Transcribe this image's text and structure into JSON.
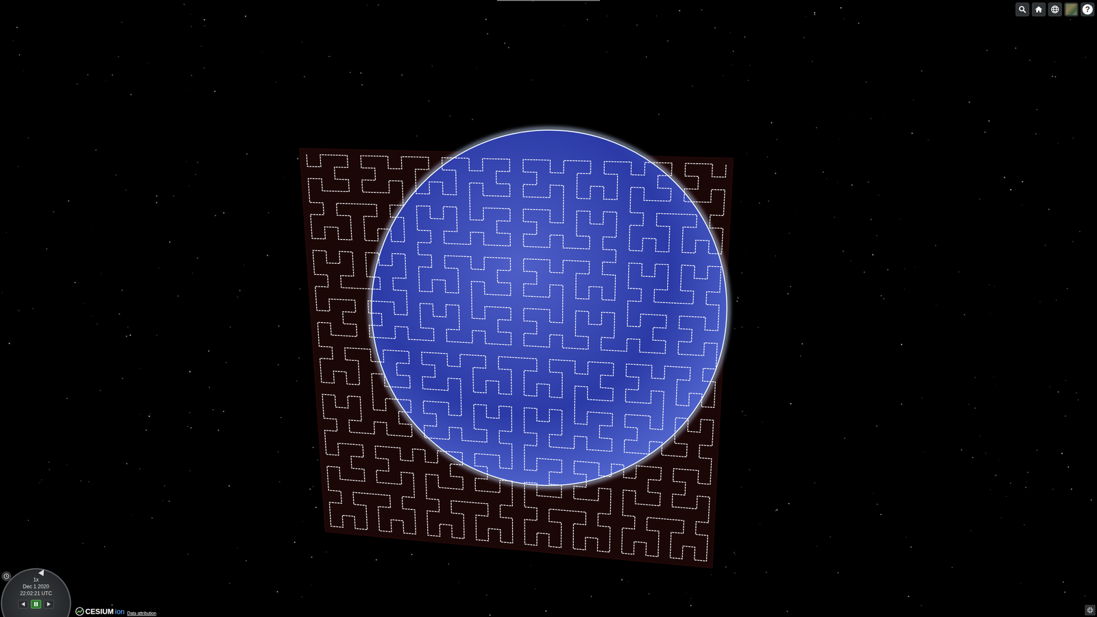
{
  "viewer": {
    "scene": {
      "curve": {
        "order": 5
      }
    }
  },
  "toolbar": [
    {
      "kind": "search"
    },
    {
      "kind": "home"
    },
    {
      "kind": "scene-mode"
    },
    {
      "kind": "imagery"
    },
    {
      "kind": "help",
      "label": "?"
    }
  ],
  "animation": {
    "speed": "1x",
    "date": "Dec 1 2020",
    "time": "22:02:21 UTC",
    "buttons": [
      {
        "kind": "reverse",
        "selected": false
      },
      {
        "kind": "pause",
        "selected": true
      },
      {
        "kind": "play",
        "selected": false
      }
    ]
  },
  "credits": {
    "logo": "CESIUM",
    "logo_suffix": "ion",
    "link": "Data attribution"
  }
}
